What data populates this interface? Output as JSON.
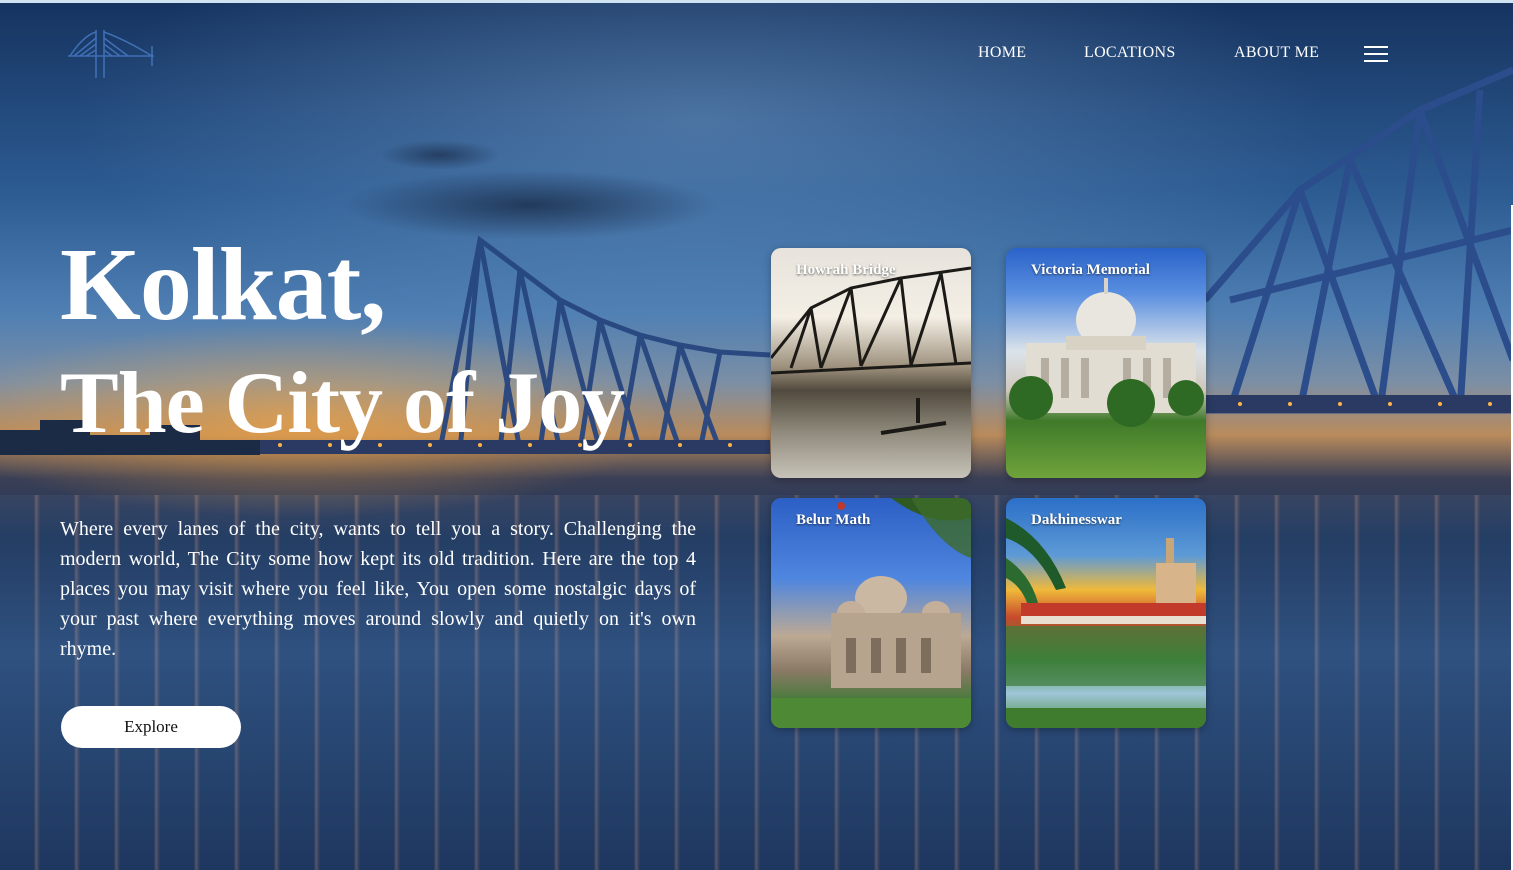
{
  "nav": {
    "home": "HOME",
    "locations": "LOCATIONS",
    "about": "ABOUT ME"
  },
  "hero": {
    "title": "Kolkat,",
    "subtitle": "The City of Joy",
    "description": "Where every lanes of the city, wants to tell you a story. Challenging the modern world, The City some how kept its old tradition. Here are the top 4 places you may visit where you feel like, You open some nostalgic days of your past where everything moves around slowly and quietly on it's own rhyme.",
    "cta": "Explore"
  },
  "places": [
    {
      "label": "Howrah Bridge"
    },
    {
      "label": "Victoria Memorial"
    },
    {
      "label": "Belur Math"
    },
    {
      "label": "Dakhinesswar"
    }
  ],
  "colors": {
    "text": "#ffffff",
    "button_bg": "#ffffff",
    "button_text": "#111111",
    "bridge": "#27467f"
  },
  "icons": {
    "logo": "bridge-logo-icon",
    "menu": "hamburger-menu-icon"
  }
}
